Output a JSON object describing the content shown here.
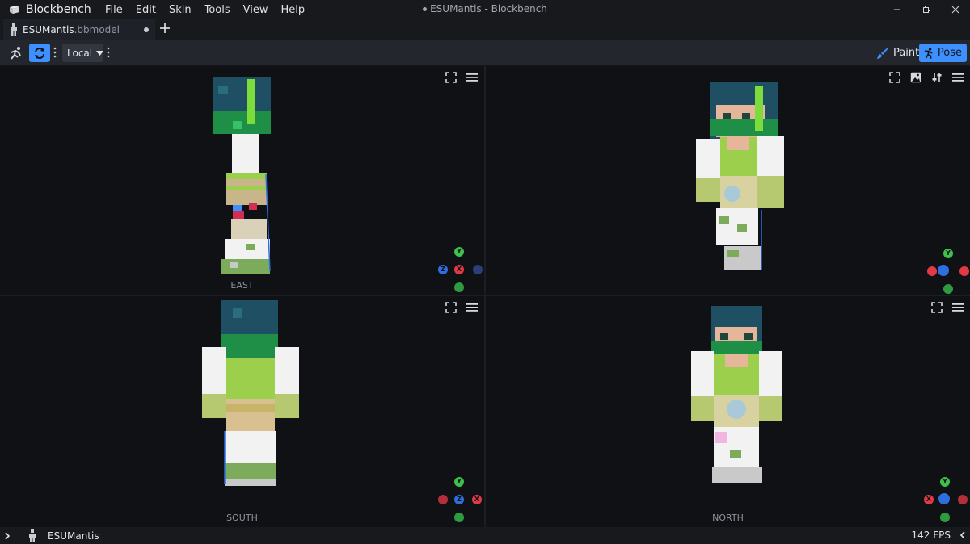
{
  "app": {
    "name": "Blockbench",
    "window_title": "ESUMantis - Blockbench",
    "menu": [
      "File",
      "Edit",
      "Skin",
      "Tools",
      "View",
      "Help"
    ]
  },
  "tab": {
    "name": "ESUMantis",
    "ext": ".bbmodel",
    "unsaved": true
  },
  "toolbar": {
    "space_select": "Local",
    "paint_label": "Paint",
    "pose_label": "Pose"
  },
  "viewports": {
    "top_left": {
      "label": "EAST"
    },
    "top_right": {
      "label": ""
    },
    "bottom_left": {
      "label": "SOUTH"
    },
    "bottom_right": {
      "label": "NORTH"
    },
    "axes": {
      "x": "X",
      "y": "Y",
      "z": "Z"
    }
  },
  "status": {
    "project": "ESUMantis",
    "fps": "142 FPS"
  },
  "colors": {
    "accent": "#3e90ff",
    "axis_x": "#e23a45",
    "axis_y": "#3fbf4b",
    "axis_z": "#2f6ee0",
    "hair_dark": "#1e4f63",
    "hair_green": "#22b04a",
    "shirt_white": "#f2f2f2",
    "vest_green": "#9ccf4b",
    "skin": "#e6b69b"
  },
  "icons": [
    "blockbench-logo-icon",
    "minimize-icon",
    "maximize-icon",
    "close-icon",
    "person-icon",
    "add-icon",
    "pose-tool-icon",
    "rotate-tool-icon",
    "chevron-down-icon",
    "more-vertical-icon",
    "brush-icon",
    "pose-icon",
    "fullscreen-icon",
    "menu-icon",
    "image-icon",
    "sliders-icon",
    "chevron-right-icon",
    "chevron-left-icon"
  ]
}
